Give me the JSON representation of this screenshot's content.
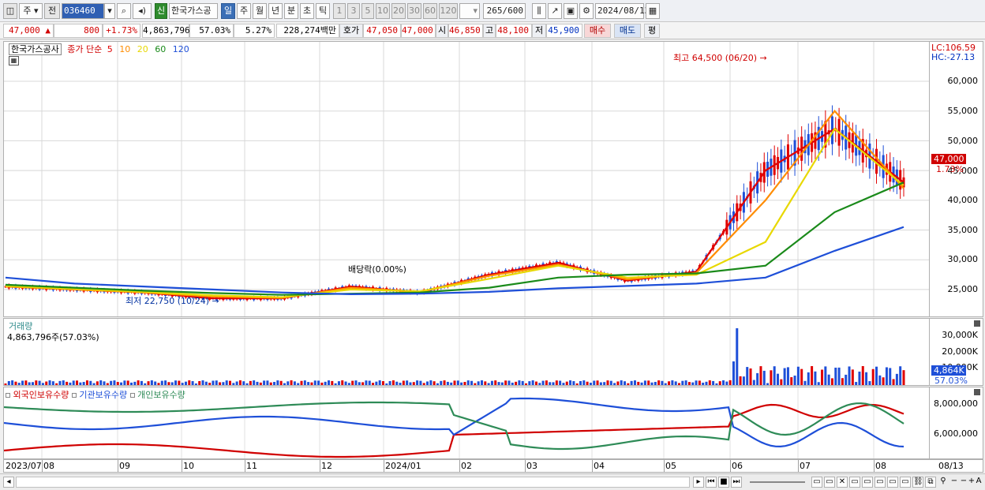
{
  "toolbar": {
    "market": "주",
    "prev_label": "전",
    "stock_code": "036460",
    "new_badge": "신",
    "stock_name": "한국가스공",
    "periods": [
      "일",
      "주",
      "월",
      "년",
      "분",
      "초",
      "틱"
    ],
    "selected_period": "일",
    "intervals": [
      "1",
      "3",
      "5",
      "10",
      "20",
      "30",
      "60",
      "120"
    ],
    "count_value": "265",
    "count_max": "/600",
    "date": "2024/08/13"
  },
  "quote": {
    "price": "47,000",
    "change": "800",
    "change_pct": "+1.73%",
    "volume": "4,863,796",
    "volume_ratio": "57.03%",
    "turnover": "5.27%",
    "amount": "228,274백만",
    "bid_label": "호가",
    "bid": "47,050",
    "ask": "47,000",
    "open_label": "시",
    "open": "46,850",
    "high_label": "고",
    "high": "48,100",
    "low_label": "저",
    "low": "45,900",
    "buy_label": "매수",
    "sell_label": "매도",
    "eval_label": "평"
  },
  "price_pane": {
    "title": "한국가스공사",
    "close_label": "종가 단순",
    "ma_periods": [
      "5",
      "10",
      "20",
      "60",
      "120"
    ],
    "ma_colors": [
      "#e00000",
      "#ff8c00",
      "#e8d800",
      "#1a8a1a",
      "#1e4fd8"
    ],
    "lc": "LC:106.59",
    "hc": "HC:-27.13",
    "y_ticks": [
      "60,000",
      "55,000",
      "50,000",
      "45,000",
      "40,000",
      "35,000",
      "30,000",
      "25,000"
    ],
    "current_price_tag": "47,000",
    "current_pct_tag": "1.73%",
    "high_note": "최고 64,500 (06/20)",
    "low_note": "최저 22,750 (10/24)",
    "dividend_note": "배당락(0.00%)"
  },
  "volume_pane": {
    "title": "거래량",
    "value": "4,863,796주(57.03%)",
    "y_ticks": [
      "30,000K",
      "20,000K",
      "10,000K"
    ],
    "current_tag": "4,864K",
    "pct_tag": "57.03%"
  },
  "holding_pane": {
    "series": [
      {
        "label": "외국인보유수량",
        "color": "#d00000"
      },
      {
        "label": "기관보유수량",
        "color": "#1e4fd8"
      },
      {
        "label": "개인보유수량",
        "color": "#2e8b57"
      }
    ],
    "y_ticks": [
      "8,000,000",
      "6,000,000"
    ]
  },
  "x_axis": {
    "labels": [
      "2023/07",
      "08",
      "09",
      "10",
      "11",
      "12",
      "2024/01",
      "02",
      "03",
      "04",
      "05",
      "06",
      "07",
      "08"
    ],
    "right_label": "08/13"
  },
  "chart_data": {
    "type": "line",
    "title": "한국가스공사",
    "x": [
      "2023/07",
      "2023/08",
      "2023/09",
      "2023/10",
      "2023/11",
      "2023/12",
      "2024/01",
      "2024/02",
      "2024/03",
      "2024/04",
      "2024/05",
      "2024/06",
      "2024/07",
      "2024/08"
    ],
    "ylim": [
      21000,
      66000
    ],
    "series": [
      {
        "name": "5",
        "values": [
          25500,
          25000,
          24500,
          23500,
          23500,
          25500,
          24500,
          27500,
          29500,
          26500,
          28000,
          45000,
          52000,
          43000
        ]
      },
      {
        "name": "10",
        "values": [
          25500,
          25000,
          24500,
          23800,
          23600,
          25300,
          24600,
          27300,
          29200,
          26700,
          27800,
          40000,
          55000,
          42000
        ]
      },
      {
        "name": "20",
        "values": [
          25600,
          25100,
          24600,
          24000,
          23700,
          25000,
          24700,
          26800,
          29000,
          27000,
          27500,
          33000,
          52000,
          42500
        ]
      },
      {
        "name": "60",
        "values": [
          25800,
          25300,
          24800,
          24400,
          24100,
          24300,
          24500,
          25300,
          27000,
          27500,
          27700,
          29000,
          38000,
          43000
        ]
      },
      {
        "name": "120",
        "values": [
          27000,
          26000,
          25500,
          25000,
          24500,
          24200,
          24300,
          24600,
          25200,
          25600,
          26000,
          27000,
          31500,
          35500
        ]
      }
    ]
  }
}
